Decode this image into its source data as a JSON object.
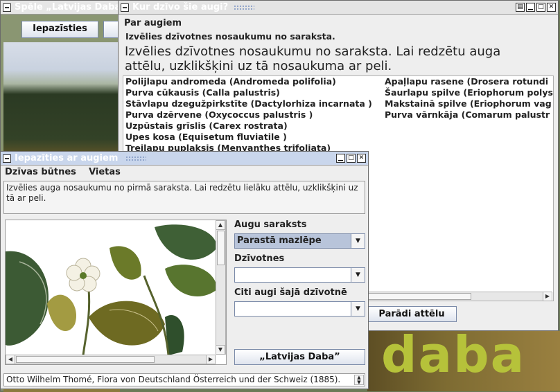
{
  "bg_window": {
    "title": "Spēle „Latvijas Daba\"",
    "button_1": "Iepazīsties"
  },
  "wordmark": "daba",
  "habitat_window": {
    "title": "Kur dzīvo šie augi?",
    "tab": "Par augiem",
    "hint_small": "Izvēlies dzīvotnes nosaukumu no saraksta.",
    "hint_large": "Izvēlies dzīvotnes nosaukumu no saraksta. Lai redzētu auga attēlu, uzklikšķini uz tā nosaukuma ar peli.",
    "col1": [
      "Polijlapu andromeda (Andromeda polifolia)",
      "Purva cūkausis (Calla palustris)",
      "Stāvlapu dzegužpirkstīte (Dactylorhiza incarnata )",
      "Purva dzērvene (Oxycoccus palustris )",
      "Uzpūstais grīslis (Carex rostrata)",
      "Upes kosa (Equisetum fluviatile )",
      "Trejlapu puplaksis (Menyanthes trifoliata)"
    ],
    "col2": [
      "Apaļlapu rasene (Drosera rotundi",
      "Šaurlapu spilve (Eriophorum polys",
      "Makstainā spilve (Eriophorum vag",
      "Purva vārnkāja (Comarum palustr"
    ],
    "show_button": "Parādi attēlu"
  },
  "plants_window": {
    "title": "Iepazīties ar augiem",
    "menu": [
      "Dzīvas būtnes",
      "Vietas"
    ],
    "instruction": "Izvēlies auga nosaukumu no pirmā saraksta. Lai redzētu lielāku attēlu, uzklikšķini uz tā ar peli.",
    "list_label": "Augu saraksts",
    "list_value": "Parastā mazlēpe",
    "habitat_label": "Dzīvotnes",
    "habitat_value": "",
    "others_label": "Citi augi šajā dzīvotnē",
    "others_value": "",
    "latvijas_button": "„Latvijas Daba”",
    "caption": "Otto Wilhelm Thomé, Flora von Deutschland Österreich und der Schweiz (1885)."
  },
  "colors": {
    "title_active": "#c9d6ec",
    "combo_selected": "#b8c4da"
  }
}
